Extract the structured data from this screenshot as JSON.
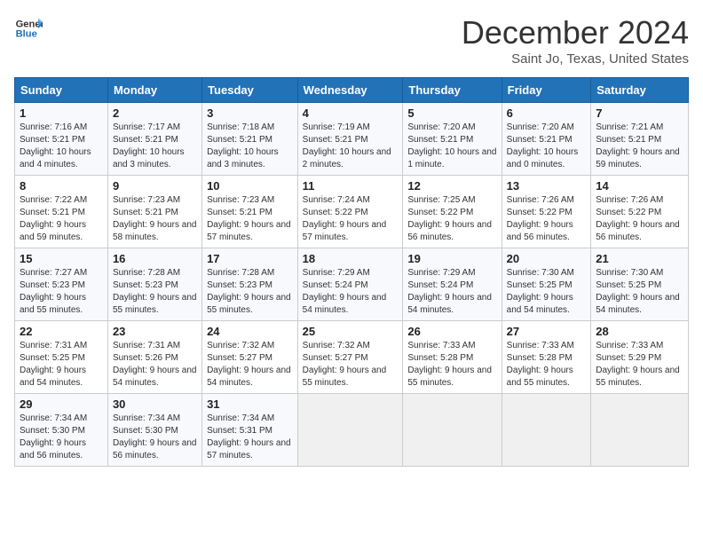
{
  "logo": {
    "line1": "General",
    "line2": "Blue"
  },
  "title": "December 2024",
  "subtitle": "Saint Jo, Texas, United States",
  "weekdays": [
    "Sunday",
    "Monday",
    "Tuesday",
    "Wednesday",
    "Thursday",
    "Friday",
    "Saturday"
  ],
  "weeks": [
    [
      {
        "day": "1",
        "sunrise": "7:16 AM",
        "sunset": "5:21 PM",
        "daylight": "10 hours and 4 minutes."
      },
      {
        "day": "2",
        "sunrise": "7:17 AM",
        "sunset": "5:21 PM",
        "daylight": "10 hours and 3 minutes."
      },
      {
        "day": "3",
        "sunrise": "7:18 AM",
        "sunset": "5:21 PM",
        "daylight": "10 hours and 3 minutes."
      },
      {
        "day": "4",
        "sunrise": "7:19 AM",
        "sunset": "5:21 PM",
        "daylight": "10 hours and 2 minutes."
      },
      {
        "day": "5",
        "sunrise": "7:20 AM",
        "sunset": "5:21 PM",
        "daylight": "10 hours and 1 minute."
      },
      {
        "day": "6",
        "sunrise": "7:20 AM",
        "sunset": "5:21 PM",
        "daylight": "10 hours and 0 minutes."
      },
      {
        "day": "7",
        "sunrise": "7:21 AM",
        "sunset": "5:21 PM",
        "daylight": "9 hours and 59 minutes."
      }
    ],
    [
      {
        "day": "8",
        "sunrise": "7:22 AM",
        "sunset": "5:21 PM",
        "daylight": "9 hours and 59 minutes."
      },
      {
        "day": "9",
        "sunrise": "7:23 AM",
        "sunset": "5:21 PM",
        "daylight": "9 hours and 58 minutes."
      },
      {
        "day": "10",
        "sunrise": "7:23 AM",
        "sunset": "5:21 PM",
        "daylight": "9 hours and 57 minutes."
      },
      {
        "day": "11",
        "sunrise": "7:24 AM",
        "sunset": "5:22 PM",
        "daylight": "9 hours and 57 minutes."
      },
      {
        "day": "12",
        "sunrise": "7:25 AM",
        "sunset": "5:22 PM",
        "daylight": "9 hours and 56 minutes."
      },
      {
        "day": "13",
        "sunrise": "7:26 AM",
        "sunset": "5:22 PM",
        "daylight": "9 hours and 56 minutes."
      },
      {
        "day": "14",
        "sunrise": "7:26 AM",
        "sunset": "5:22 PM",
        "daylight": "9 hours and 56 minutes."
      }
    ],
    [
      {
        "day": "15",
        "sunrise": "7:27 AM",
        "sunset": "5:23 PM",
        "daylight": "9 hours and 55 minutes."
      },
      {
        "day": "16",
        "sunrise": "7:28 AM",
        "sunset": "5:23 PM",
        "daylight": "9 hours and 55 minutes."
      },
      {
        "day": "17",
        "sunrise": "7:28 AM",
        "sunset": "5:23 PM",
        "daylight": "9 hours and 55 minutes."
      },
      {
        "day": "18",
        "sunrise": "7:29 AM",
        "sunset": "5:24 PM",
        "daylight": "9 hours and 54 minutes."
      },
      {
        "day": "19",
        "sunrise": "7:29 AM",
        "sunset": "5:24 PM",
        "daylight": "9 hours and 54 minutes."
      },
      {
        "day": "20",
        "sunrise": "7:30 AM",
        "sunset": "5:25 PM",
        "daylight": "9 hours and 54 minutes."
      },
      {
        "day": "21",
        "sunrise": "7:30 AM",
        "sunset": "5:25 PM",
        "daylight": "9 hours and 54 minutes."
      }
    ],
    [
      {
        "day": "22",
        "sunrise": "7:31 AM",
        "sunset": "5:25 PM",
        "daylight": "9 hours and 54 minutes."
      },
      {
        "day": "23",
        "sunrise": "7:31 AM",
        "sunset": "5:26 PM",
        "daylight": "9 hours and 54 minutes."
      },
      {
        "day": "24",
        "sunrise": "7:32 AM",
        "sunset": "5:27 PM",
        "daylight": "9 hours and 54 minutes."
      },
      {
        "day": "25",
        "sunrise": "7:32 AM",
        "sunset": "5:27 PM",
        "daylight": "9 hours and 55 minutes."
      },
      {
        "day": "26",
        "sunrise": "7:33 AM",
        "sunset": "5:28 PM",
        "daylight": "9 hours and 55 minutes."
      },
      {
        "day": "27",
        "sunrise": "7:33 AM",
        "sunset": "5:28 PM",
        "daylight": "9 hours and 55 minutes."
      },
      {
        "day": "28",
        "sunrise": "7:33 AM",
        "sunset": "5:29 PM",
        "daylight": "9 hours and 55 minutes."
      }
    ],
    [
      {
        "day": "29",
        "sunrise": "7:34 AM",
        "sunset": "5:30 PM",
        "daylight": "9 hours and 56 minutes."
      },
      {
        "day": "30",
        "sunrise": "7:34 AM",
        "sunset": "5:30 PM",
        "daylight": "9 hours and 56 minutes."
      },
      {
        "day": "31",
        "sunrise": "7:34 AM",
        "sunset": "5:31 PM",
        "daylight": "9 hours and 57 minutes."
      },
      null,
      null,
      null,
      null
    ]
  ]
}
